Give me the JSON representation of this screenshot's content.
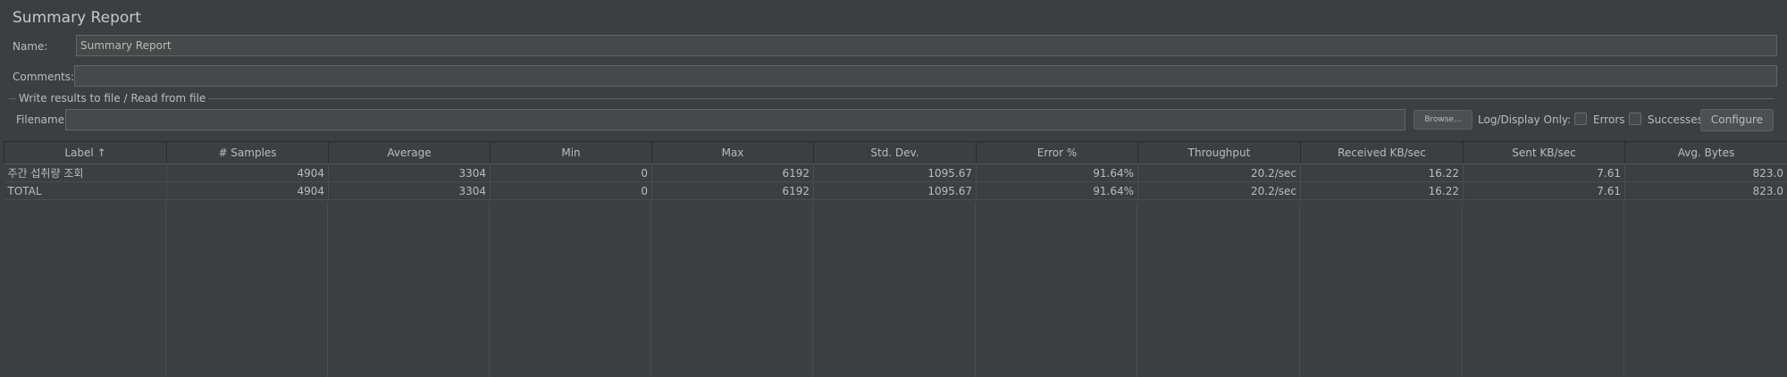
{
  "title": "Summary Report",
  "name_label": "Name:",
  "name_value": "Summary Report",
  "comments_label": "Comments:",
  "comments_value": "",
  "file_group_label": "Write results to file / Read from file",
  "filename_label": "Filename",
  "filename_value": "",
  "browse_label": "Browse...",
  "log_display_label": "Log/Display Only:",
  "errors_label": "Errors",
  "errors_checked": false,
  "successes_label": "Successes",
  "successes_checked": false,
  "configure_label": "Configure",
  "table": {
    "columns": [
      "Label ↑",
      "# Samples",
      "Average",
      "Min",
      "Max",
      "Std. Dev.",
      "Error %",
      "Throughput",
      "Received KB/sec",
      "Sent KB/sec",
      "Avg. Bytes"
    ],
    "rows": [
      [
        "주간 섭취량 조회",
        "4904",
        "3304",
        "0",
        "6192",
        "1095.67",
        "91.64%",
        "20.2/sec",
        "16.22",
        "7.61",
        "823.0"
      ],
      [
        "TOTAL",
        "4904",
        "3304",
        "0",
        "6192",
        "1095.67",
        "91.64%",
        "20.2/sec",
        "16.22",
        "7.61",
        "823.0"
      ]
    ]
  }
}
